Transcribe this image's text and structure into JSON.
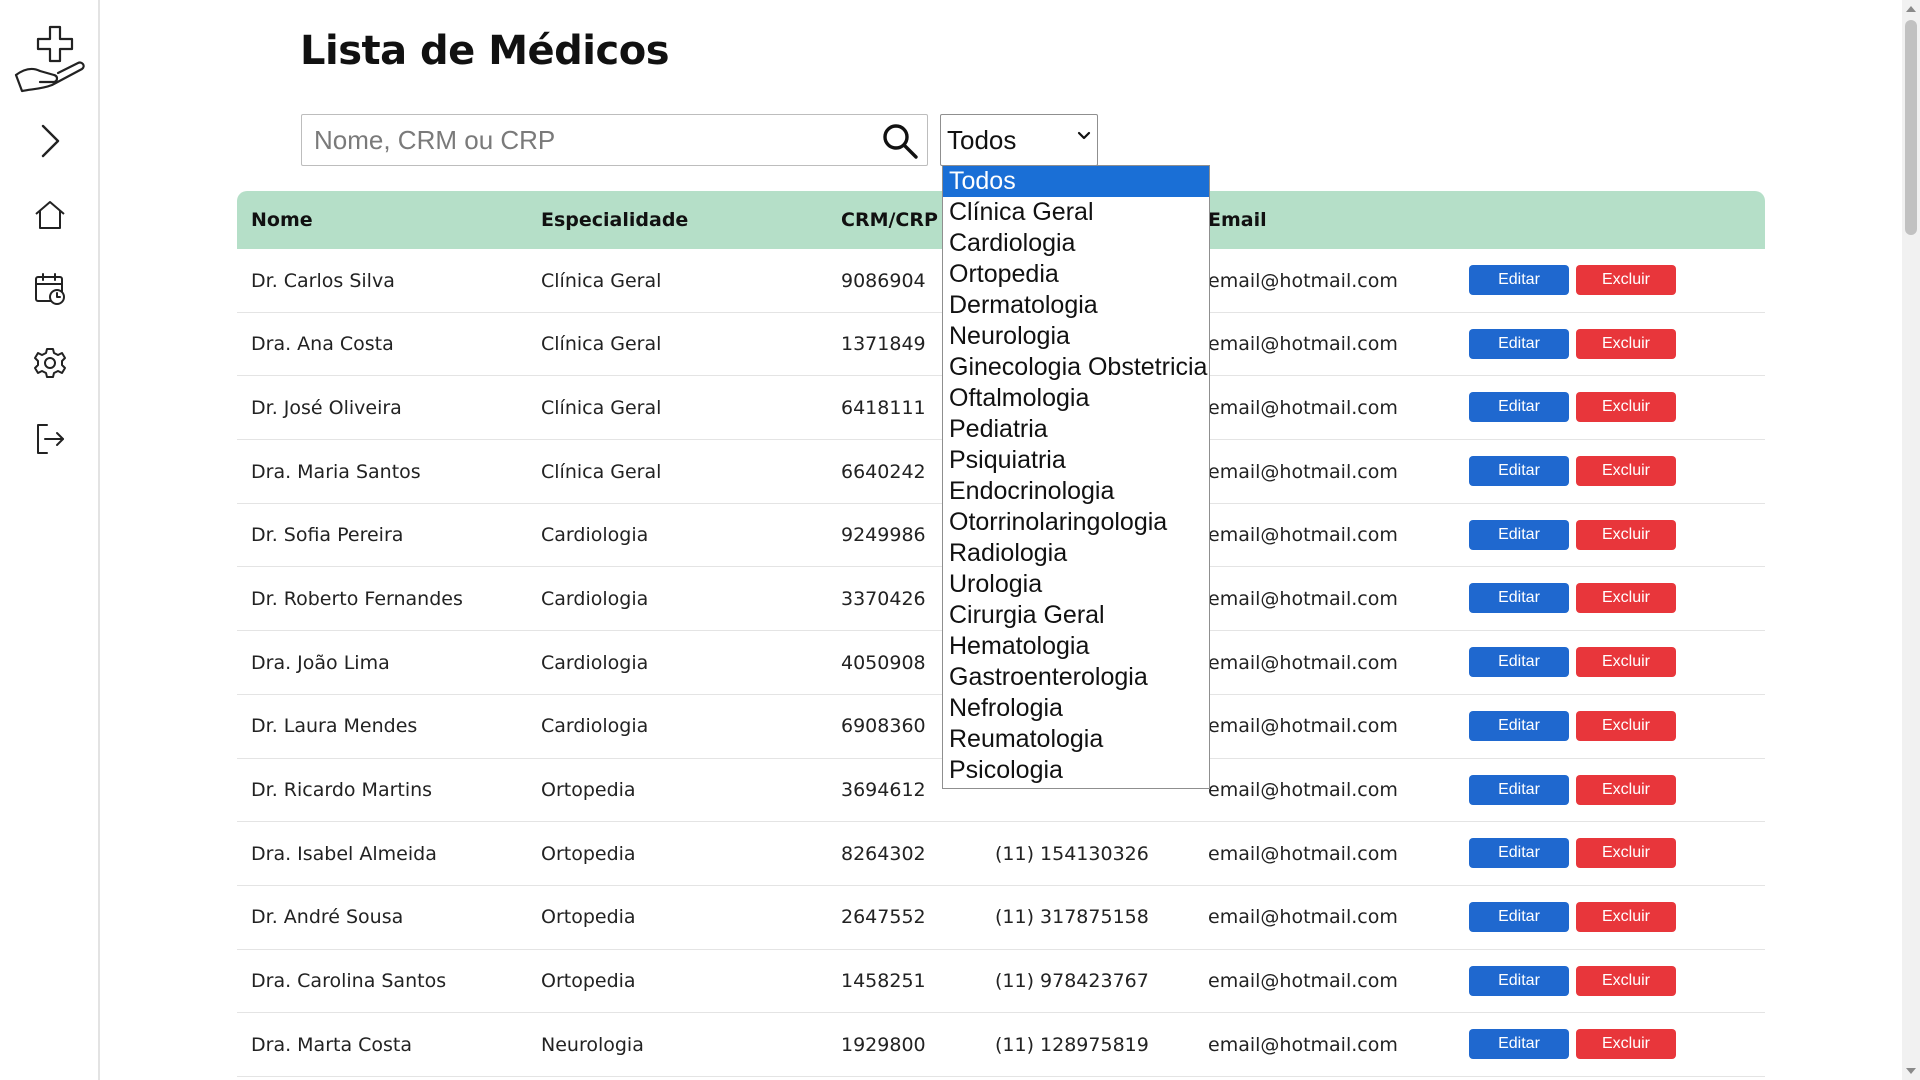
{
  "page": {
    "title": "Lista de Médicos"
  },
  "sidebar": {
    "items": [
      {
        "name": "logo",
        "icon": "hand-medical-cross-icon"
      },
      {
        "name": "expand",
        "icon": "chevron-right-icon"
      },
      {
        "name": "home",
        "icon": "home-icon"
      },
      {
        "name": "calendar",
        "icon": "calendar-clock-icon"
      },
      {
        "name": "settings",
        "icon": "gear-icon"
      },
      {
        "name": "logout",
        "icon": "logout-icon"
      }
    ]
  },
  "search": {
    "placeholder": "Nome, CRM ou CRP",
    "value": "",
    "icon": "search-icon"
  },
  "filter": {
    "selected": "Todos",
    "options": [
      "Todos",
      "Clínica Geral",
      "Cardiologia",
      "Ortopedia",
      "Dermatologia",
      "Neurologia",
      "Ginecologia Obstetricia",
      "Oftalmologia",
      "Pediatria",
      "Psiquiatria",
      "Endocrinologia",
      "Otorrinolaringologia",
      "Radiologia",
      "Urologia",
      "Cirurgia Geral",
      "Hematologia",
      "Gastroenterologia",
      "Nefrologia",
      "Reumatologia",
      "Psicologia"
    ]
  },
  "table": {
    "headers": {
      "name": "Nome",
      "specialty": "Especialidade",
      "crm": "CRM/CRP",
      "email": "Email"
    },
    "edit_label": "Editar",
    "delete_label": "Excluir",
    "rows": [
      {
        "name": "Dr. Carlos Silva",
        "specialty": "Clínica Geral",
        "crm": "9086904",
        "phone": "",
        "email": "email@hotmail.com"
      },
      {
        "name": "Dra. Ana Costa",
        "specialty": "Clínica Geral",
        "crm": "1371849",
        "phone": "",
        "email": "email@hotmail.com"
      },
      {
        "name": "Dr. José Oliveira",
        "specialty": "Clínica Geral",
        "crm": "6418111",
        "phone": "",
        "email": "email@hotmail.com"
      },
      {
        "name": "Dra. Maria Santos",
        "specialty": "Clínica Geral",
        "crm": "6640242",
        "phone": "",
        "email": "email@hotmail.com"
      },
      {
        "name": "Dr. Sofia Pereira",
        "specialty": "Cardiologia",
        "crm": "9249986",
        "phone": "",
        "email": "email@hotmail.com"
      },
      {
        "name": "Dr. Roberto Fernandes",
        "specialty": "Cardiologia",
        "crm": "3370426",
        "phone": "",
        "email": "email@hotmail.com"
      },
      {
        "name": "Dra. João Lima",
        "specialty": "Cardiologia",
        "crm": "4050908",
        "phone": "",
        "email": "email@hotmail.com"
      },
      {
        "name": "Dr. Laura Mendes",
        "specialty": "Cardiologia",
        "crm": "6908360",
        "phone": "",
        "email": "email@hotmail.com"
      },
      {
        "name": "Dr. Ricardo Martins",
        "specialty": "Ortopedia",
        "crm": "3694612",
        "phone": "",
        "email": "email@hotmail.com"
      },
      {
        "name": "Dra. Isabel Almeida",
        "specialty": "Ortopedia",
        "crm": "8264302",
        "phone": "(11) 154130326",
        "email": "email@hotmail.com"
      },
      {
        "name": "Dr. André Sousa",
        "specialty": "Ortopedia",
        "crm": "2647552",
        "phone": "(11) 317875158",
        "email": "email@hotmail.com"
      },
      {
        "name": "Dra. Carolina Santos",
        "specialty": "Ortopedia",
        "crm": "1458251",
        "phone": "(11) 978423767",
        "email": "email@hotmail.com"
      },
      {
        "name": "Dra. Marta Costa",
        "specialty": "Neurologia",
        "crm": "1929800",
        "phone": "(11) 128975819",
        "email": "email@hotmail.com"
      }
    ]
  },
  "colors": {
    "header_bg": "#b5dfc8",
    "edit_button": "#1f68cf",
    "delete_button": "#e8363b",
    "dropdown_highlight": "#1a6fd6"
  }
}
